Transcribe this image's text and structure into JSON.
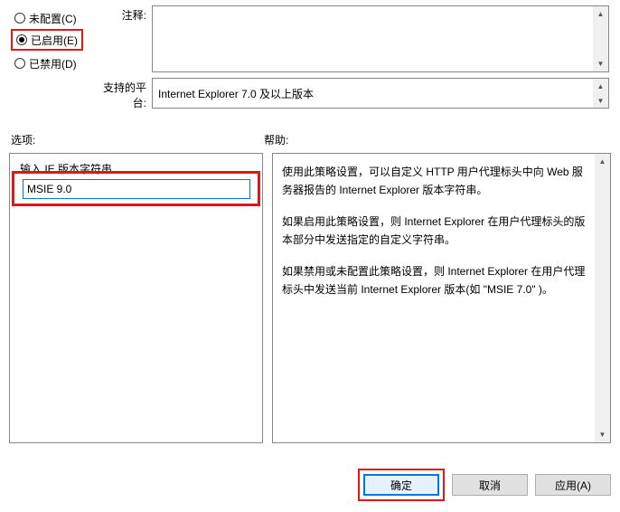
{
  "radios": {
    "not_configured": "未配置(C)",
    "enabled": "已启用(E)",
    "disabled": "已禁用(D)"
  },
  "labels": {
    "comment": "注释:",
    "supported_on": "支持的平台:",
    "options": "选项:",
    "help": "帮助:",
    "version_string_label": "输入 IE 版本字符串"
  },
  "fields": {
    "comment_value": "",
    "supported_on_value": "Internet Explorer 7.0 及以上版本",
    "version_string_value": "MSIE 9.0"
  },
  "help_text": {
    "p1": "使用此策略设置，可以自定义 HTTP 用户代理标头中向 Web 服务器报告的 Internet Explorer 版本字符串。",
    "p2": "如果启用此策略设置，则 Internet Explorer 在用户代理标头的版本部分中发送指定的自定义字符串。",
    "p3": "如果禁用或未配置此策略设置，则 Internet Explorer 在用户代理标头中发送当前 Internet Explorer 版本(如 \"MSIE 7.0\" )。"
  },
  "buttons": {
    "ok": "确定",
    "cancel": "取消",
    "apply": "应用(A)"
  }
}
